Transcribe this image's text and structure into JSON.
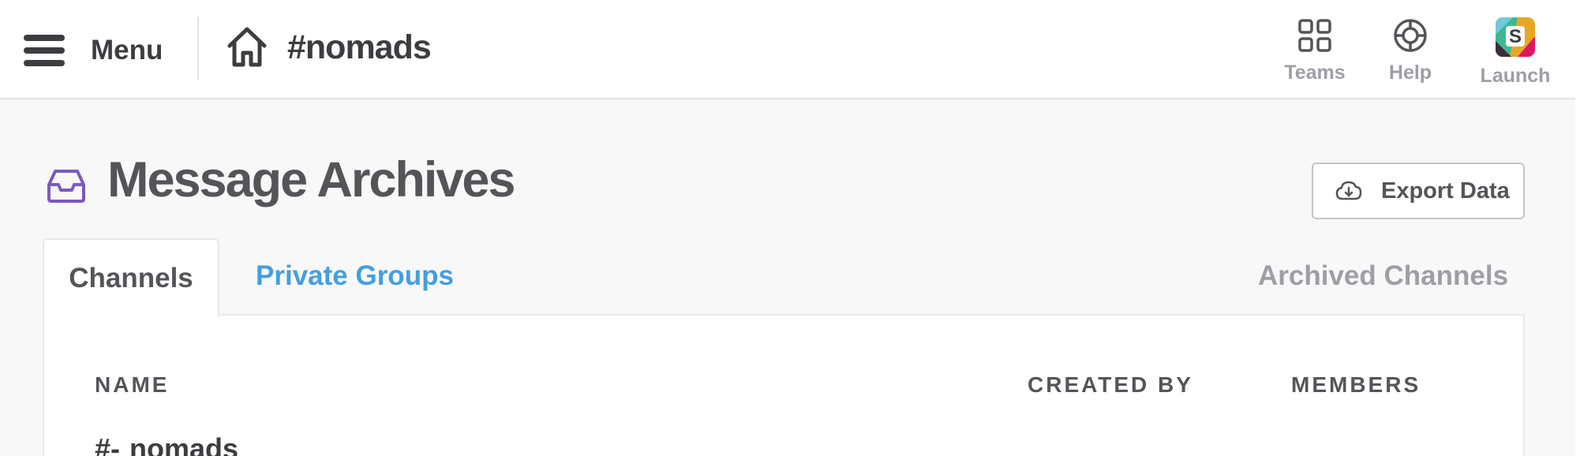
{
  "header": {
    "menu_label": "Menu",
    "channel_title": "#nomads",
    "actions": [
      {
        "label": "Teams",
        "icon": "grid-icon"
      },
      {
        "label": "Help",
        "icon": "lifebuoy-icon"
      },
      {
        "label": "Launch",
        "icon": "slack-logo-icon"
      }
    ]
  },
  "page": {
    "title": "Message Archives",
    "title_icon": "archive-inbox-icon",
    "export_label": "Export Data",
    "accent_color": "#7b59c0"
  },
  "tabs": {
    "active": "Channels",
    "private": "Private Groups",
    "archived": "Archived Channels",
    "link_color": "#439fe0"
  },
  "table": {
    "columns": [
      "NAME",
      "CREATED BY",
      "MEMBERS"
    ],
    "rows": [
      {
        "prefix": "#-",
        "name": "nomads"
      }
    ]
  }
}
